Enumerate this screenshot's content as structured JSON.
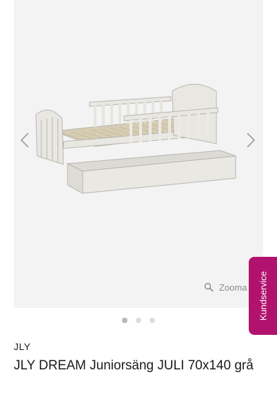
{
  "gallery": {
    "zoom_label": "Zooma",
    "image_count": 3,
    "active_image": 1,
    "prev_icon": "chevron-left-icon",
    "next_icon": "chevron-right-icon",
    "zoom_icon": "magnifier-icon"
  },
  "side_tab": {
    "label": "Kundservice",
    "color": "#b0126e"
  },
  "product": {
    "brand": "JLY",
    "title": "JLY DREAM Juniorsäng JULI 70x140 grå"
  }
}
